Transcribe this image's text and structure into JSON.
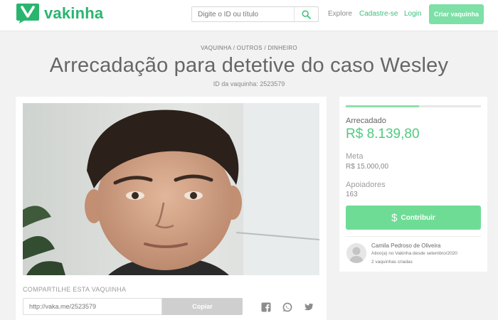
{
  "header": {
    "logo_text": "vakinha",
    "search_placeholder": "Digite o ID ou título",
    "nav_explore": "Explore",
    "nav_signup": "Cadastre-se",
    "nav_login": "Login",
    "create_button": "Criar vaquinha"
  },
  "page": {
    "breadcrumb": "VAQUINHA / OUTROS / DINHEIRO",
    "title": "Arrecadação para detetive do caso Wesley",
    "id_text": "ID da vaquinha: 2523579"
  },
  "share": {
    "label": "COMPARTILHE ESTA VAQUINHA",
    "link": "http://vaka.me/2523579",
    "copy_button": "Copiar",
    "icons": [
      "facebook-icon",
      "whatsapp-icon",
      "twitter-icon"
    ]
  },
  "campaign": {
    "raised_label": "Arrecadado",
    "raised_value": "R$ 8.139,80",
    "goal_label": "Meta",
    "goal_value": "R$ 15.000,00",
    "supporters_label": "Apoiadores",
    "supporters_value": "163",
    "progress_fraction": 0.543,
    "contribute_symbol": "$",
    "contribute_button": "Contribuir"
  },
  "owner": {
    "name": "Camila Pedroso de Oliveira",
    "since": "Ativo(a) no Vakinha desde setembro/2020",
    "count": "2 vaquinhas criadas"
  },
  "colors": {
    "brand_green": "#2ab56f",
    "accent_green": "#4fcb7f",
    "button_green": "#6fdc96",
    "copy_gray": "#cfcfcf"
  }
}
